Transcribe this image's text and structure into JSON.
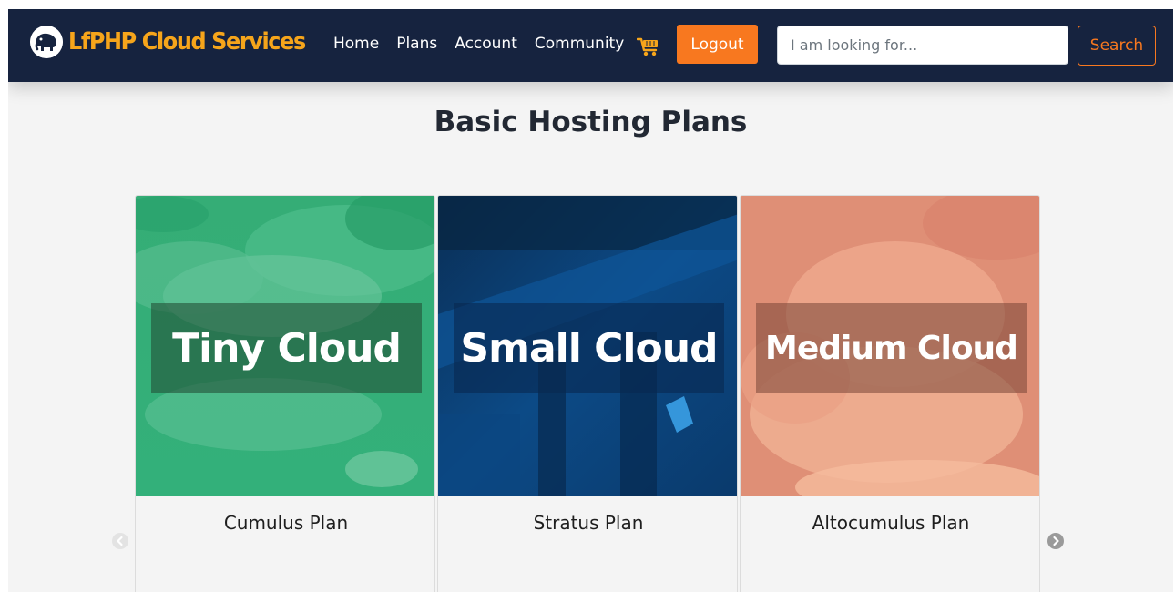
{
  "navbar": {
    "brand": "LfPHP Cloud Services",
    "links": [
      "Home",
      "Plans",
      "Account",
      "Community"
    ],
    "cart_icon": "cart-icon",
    "logout_label": "Logout",
    "search_placeholder": "I am looking for...",
    "search_label": "Search"
  },
  "main": {
    "title": "Basic Hosting Plans"
  },
  "carousel": {
    "cards": [
      {
        "image_text": "Tiny Cloud",
        "title": "Cumulus Plan",
        "color": "#3cb37d"
      },
      {
        "image_text": "Small Cloud",
        "title": "Stratus Plan",
        "color": "#0b3a6e"
      },
      {
        "image_text": "Medium Cloud",
        "title": "Altocumulus Plan",
        "color": "#e2937a"
      }
    ],
    "prev_icon": "chevron-left-icon",
    "next_icon": "chevron-right-icon"
  },
  "colors": {
    "navbar_bg": "#16233f",
    "brand": "#f6a51b",
    "accent": "#f8781f"
  }
}
